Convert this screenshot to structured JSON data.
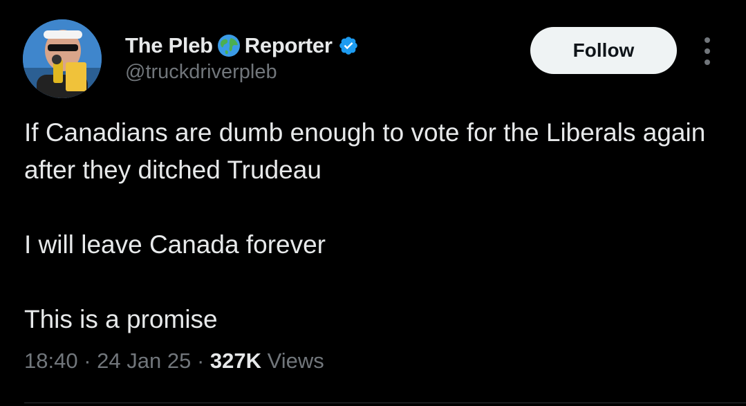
{
  "user": {
    "display_name_part1": "The Pleb",
    "display_name_part2": "Reporter",
    "handle": "@truckdriverpleb",
    "name_emoji": "globe-icon",
    "verified_badge": "verified-icon",
    "verified_color": "#1d9bf0"
  },
  "actions": {
    "follow_label": "Follow",
    "more_icon": "more-icon"
  },
  "tweet": {
    "lines": [
      "If Canadians are dumb enough to vote for the Liberals again after they ditched Trudeau",
      "I will leave Canada forever",
      "This is a promise"
    ]
  },
  "meta": {
    "time": "18:40",
    "separator": "·",
    "date": "24 Jan 25",
    "views_count": "327K",
    "views_label": "Views"
  },
  "colors": {
    "background": "#000000",
    "primary_text": "#e7e9ea",
    "secondary_text": "#71767b",
    "follow_bg": "#eff3f4"
  }
}
